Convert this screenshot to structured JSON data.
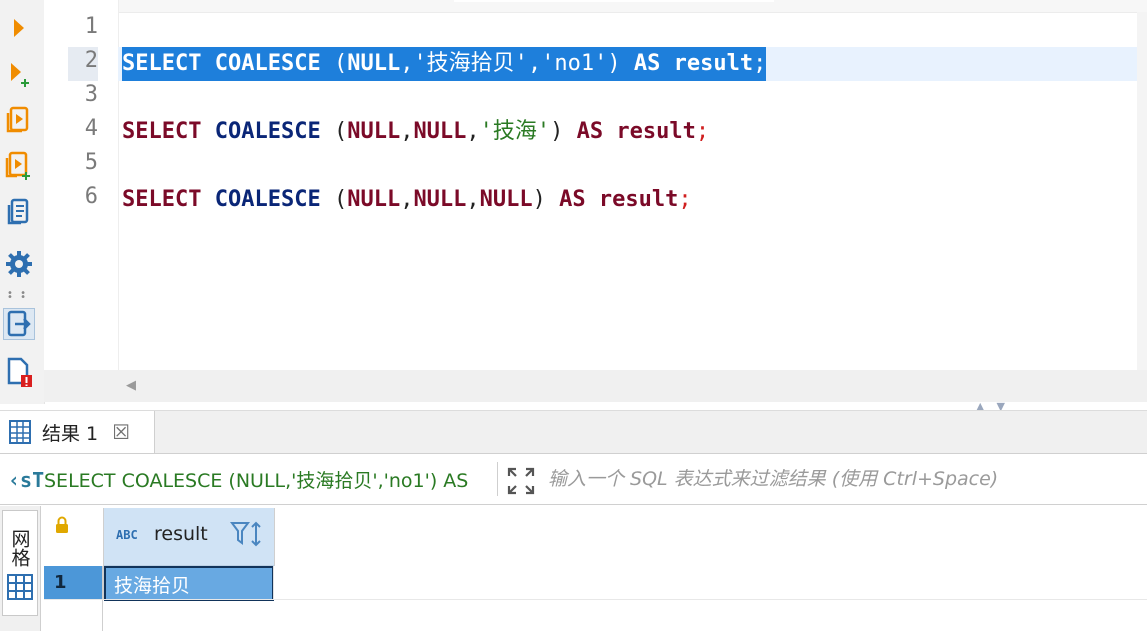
{
  "editor": {
    "line_numbers": [
      "1",
      "2",
      "3",
      "4",
      "5",
      "6"
    ],
    "lines": [
      {
        "kw1": "SELECT",
        "fn": "COALESCE",
        "open": " (",
        "args": [
          {
            "t": "nul",
            "v": "NULL"
          },
          {
            "t": "pun",
            "v": ","
          },
          {
            "t": "str",
            "v": "'技海拾贝'"
          },
          {
            "t": "pun",
            "v": ","
          },
          {
            "t": "str",
            "v": "'no1'"
          }
        ],
        "close": ")",
        "kw2": "AS",
        "alias": "result",
        "semi": ";"
      },
      {
        "kw1": "SELECT",
        "fn": "COALESCE",
        "open": " (",
        "args": [
          {
            "t": "nul",
            "v": "NULL"
          },
          {
            "t": "pun",
            "v": ","
          },
          {
            "t": "nul",
            "v": "NULL"
          },
          {
            "t": "pun",
            "v": ","
          },
          {
            "t": "str",
            "v": "'技海'"
          }
        ],
        "close": ")",
        "kw2": "AS",
        "alias": "result",
        "semi": ";"
      },
      {
        "kw1": "SELECT",
        "fn": "COALESCE",
        "open": " (",
        "args": [
          {
            "t": "nul",
            "v": "NULL"
          },
          {
            "t": "pun",
            "v": ","
          },
          {
            "t": "nul",
            "v": "NULL"
          },
          {
            "t": "pun",
            "v": ","
          },
          {
            "t": "nul",
            "v": "NULL"
          }
        ],
        "close": ")",
        "kw2": "AS",
        "alias": "result",
        "semi": ";"
      }
    ]
  },
  "toolbar": {
    "icons": [
      "execute-statement-icon",
      "execute-new-tab-icon",
      "execute-script-icon",
      "execute-script-new-tab-icon",
      "explain-plan-icon",
      "settings-icon",
      "export-icon",
      "script-error-icon"
    ]
  },
  "results": {
    "tab_label": "结果 1",
    "close_glyph": "☒",
    "filter_sql_icon": "‹sT",
    "filter_sql": "SELECT COALESCE (NULL,'技海拾贝','no1') AS",
    "filter_placeholder": "输入一个 SQL 表达式来过滤结果 (使用 Ctrl+Space)",
    "side_tab_label": "网格",
    "column": {
      "type": "ABC",
      "name": "result"
    },
    "rows": [
      {
        "num": "1",
        "value": "技海拾贝"
      }
    ]
  },
  "colors": {
    "selection": "#1e7fdb",
    "keyword": "#7b0a28",
    "function": "#0a2677",
    "string": "#2a7a23",
    "accent_orange": "#f08c00"
  }
}
